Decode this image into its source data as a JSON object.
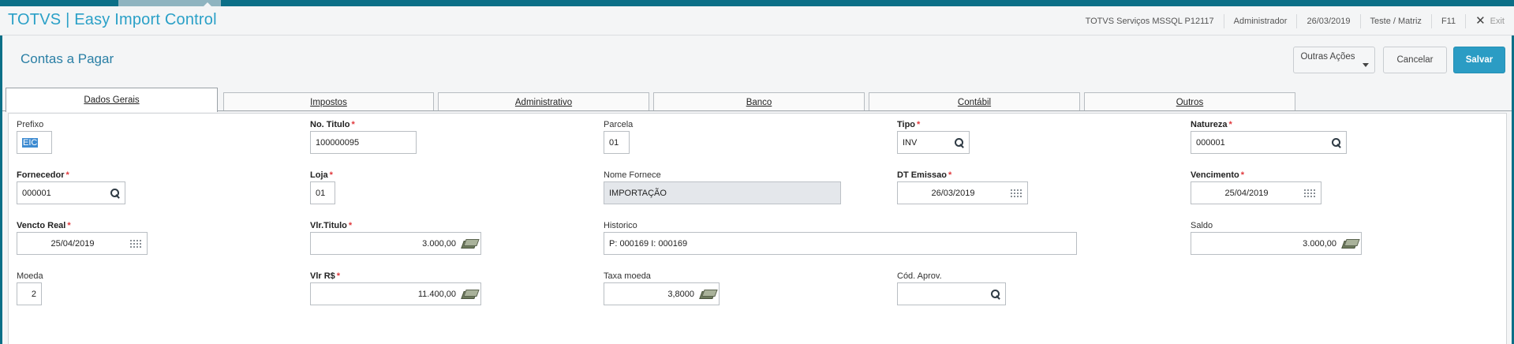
{
  "header": {
    "app_title": "TOTVS | Easy Import Control",
    "environment": "TOTVS Serviços MSSQL P12117",
    "user": "Administrador",
    "date": "26/03/2019",
    "company": "Teste / Matriz",
    "help_key": "F11",
    "exit_label": "Exit"
  },
  "titlebar": {
    "page_title": "Contas a Pagar",
    "other_actions_label": "Outras Ações",
    "cancel_label": "Cancelar",
    "save_label": "Salvar"
  },
  "tabs": [
    {
      "label": "Dados Gerais",
      "active": true
    },
    {
      "label": "Impostos"
    },
    {
      "label": "Administrativo"
    },
    {
      "label": "Banco"
    },
    {
      "label": "Contábil"
    },
    {
      "label": "Outros"
    }
  ],
  "form": {
    "prefixo": {
      "label": "Prefixo",
      "value": "EIC"
    },
    "no_titulo": {
      "label": "No. Titulo",
      "value": "100000095"
    },
    "parcela": {
      "label": "Parcela",
      "value": "01"
    },
    "tipo": {
      "label": "Tipo",
      "value": "INV"
    },
    "natureza": {
      "label": "Natureza",
      "value": "000001"
    },
    "fornecedor": {
      "label": "Fornecedor",
      "value": "000001"
    },
    "loja": {
      "label": "Loja",
      "value": "01"
    },
    "nome_fornece": {
      "label": "Nome Fornece",
      "value": "IMPORTAÇÃO"
    },
    "dt_emissao": {
      "label": "DT Emissao",
      "value": "26/03/2019"
    },
    "vencimento": {
      "label": "Vencimento",
      "value": "25/04/2019"
    },
    "vencto_real": {
      "label": "Vencto Real",
      "value": "25/04/2019"
    },
    "vlr_titulo": {
      "label": "Vlr.Titulo",
      "value": "3.000,00"
    },
    "historico": {
      "label": "Historico",
      "value": "P: 000169 I: 000169"
    },
    "saldo": {
      "label": "Saldo",
      "value": "3.000,00"
    },
    "moeda": {
      "label": "Moeda",
      "value": "2"
    },
    "vlr_rs": {
      "label": "Vlr R$",
      "value": "11.400,00"
    },
    "taxa_moeda": {
      "label": "Taxa moeda",
      "value": "3,8000"
    },
    "cod_aprov": {
      "label": "Cód. Aprov.",
      "value": ""
    }
  },
  "required_mark": "*",
  "colors": {
    "brand_teal": "#0b6f87",
    "title_blue": "#2aa0c7",
    "save_button": "#2b9cc4",
    "required_red": "#e0383c"
  }
}
